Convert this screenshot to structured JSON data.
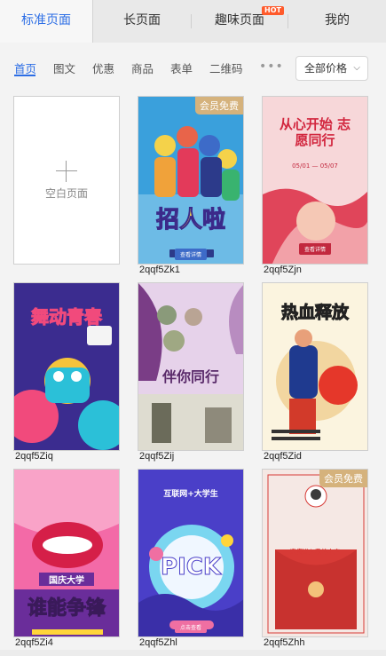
{
  "top_tabs": [
    {
      "label": "标准页面",
      "active": true
    },
    {
      "label": "长页面"
    },
    {
      "label": "趣味页面",
      "badge": "HOT"
    },
    {
      "label": "我的"
    }
  ],
  "filters": [
    "首页",
    "图文",
    "优惠",
    "商品",
    "表单",
    "二维码"
  ],
  "price_select": {
    "value": "全部价格"
  },
  "blank_card": {
    "label": "空白页面"
  },
  "templates": [
    {
      "code": "2qqf5Zk1",
      "badge": "会员免费",
      "title": "招人啦",
      "button": "查看详情",
      "subtitle": "",
      "colors": [
        "#3aa0dc",
        "#f4d24a",
        "#3d6bc8"
      ]
    },
    {
      "code": "2qqf5Zjn",
      "badge": "",
      "title": "从心开始 志愿同行",
      "button": "查看详情",
      "subtitle": "05/01 — 05/07",
      "colors": [
        "#f7d7d9",
        "#e0455a",
        "#c2283e"
      ]
    },
    {
      "code": "2qqf5Ziq",
      "badge": "",
      "title": "舞动青春",
      "button": "",
      "subtitle": "",
      "colors": [
        "#3b2c8f",
        "#f14a7c",
        "#2bc0d8"
      ]
    },
    {
      "code": "2qqf5Zij",
      "badge": "",
      "title": "伴你同行",
      "button": "",
      "subtitle": "",
      "colors": [
        "#e6d2ea",
        "#7a3d86",
        "#dedcd0"
      ]
    },
    {
      "code": "2qqf5Zid",
      "badge": "",
      "title": "热血释放",
      "button": "",
      "subtitle": "",
      "colors": [
        "#fbf4df",
        "#e5372a",
        "#1f3a8f"
      ]
    },
    {
      "code": "2qqf5Zi4",
      "badge": "",
      "title": "谁能争锋",
      "button": "",
      "subtitle": "国庆大学",
      "colors": [
        "#f36aa7",
        "#6a2d9a",
        "#ffd53a"
      ]
    },
    {
      "code": "2qqf5Zhl",
      "badge": "",
      "title": "PICK",
      "button": "点击查看",
      "subtitle": "互联网+大学生",
      "colors": [
        "#4a3fc8",
        "#7ad6f0",
        "#ef6fa2"
      ]
    },
    {
      "code": "2qqf5Zhh",
      "badge": "会员免费",
      "title": "邀您进入我的小店",
      "button": "",
      "subtitle": "",
      "colors": [
        "#f5e8e4",
        "#d73a36",
        "#c8322f"
      ]
    }
  ]
}
